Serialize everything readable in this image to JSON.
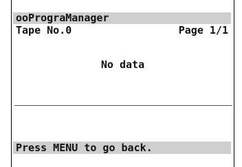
{
  "header": {
    "title": "ooPrograManager"
  },
  "info": {
    "tape_label": "Tape No.0",
    "page_label": "Page 1/1"
  },
  "main": {
    "empty_message": "No data"
  },
  "footer": {
    "hint": "Press MENU to go back."
  },
  "colors": {
    "highlight_bar": "#cfcfcf",
    "text": "#111111",
    "background": "#ffffff"
  }
}
